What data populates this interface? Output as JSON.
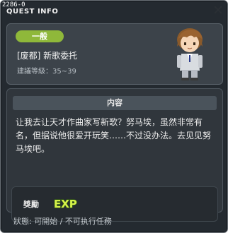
{
  "window": {
    "id_label": "2286-0",
    "title": "QUEST INFO"
  },
  "quest": {
    "category_badge": "一般",
    "name": "[废都] 新歌委托",
    "level": "建議等級：35~39"
  },
  "content": {
    "header": "内容",
    "description": "让我去让天才作曲家写新歌？努马埃，虽然非常有名，但据说他很爱开玩笑……不过没办法。去见见努马埃吧。"
  },
  "reward": {
    "label": "獎勵",
    "exp_text": "EXP"
  },
  "status": {
    "text": "狀態: 可開始 / 不可执行任務"
  },
  "colors": {
    "badge_green": "#8fb83a",
    "exp_yellow": "#d6f24a"
  },
  "icons": {
    "close": "close-icon",
    "avatar": "character-avatar",
    "exp": "exp-icon"
  }
}
